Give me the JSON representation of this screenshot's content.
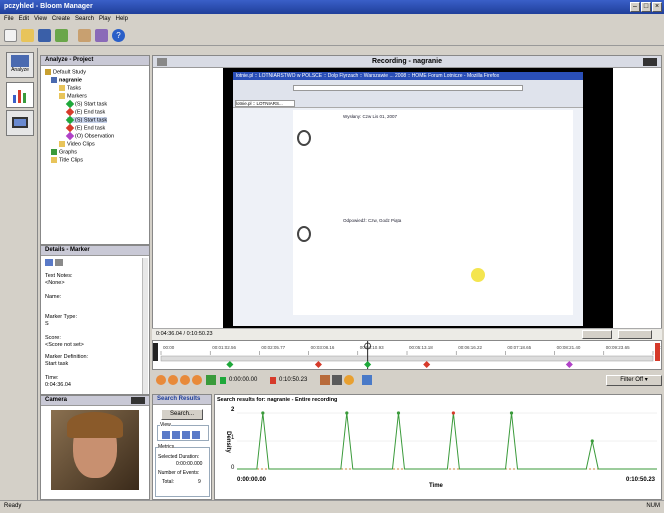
{
  "window": {
    "title": "pczyhled - Bloom Manager"
  },
  "menu": [
    "File",
    "Edit",
    "View",
    "Create",
    "Search",
    "Play",
    "Help"
  ],
  "toolbar_icons": [
    "new-icon",
    "open-icon",
    "save-icon",
    "import-icon",
    "users-icon",
    "export-icon",
    "help-icon"
  ],
  "leftnav": {
    "analyze_label": "Analyze"
  },
  "project": {
    "title": "Analyze - Project",
    "items": [
      {
        "label": "Default Study",
        "icon": "study-icon"
      },
      {
        "label": "nagranie",
        "icon": "recording-icon"
      },
      {
        "label": "Tasks",
        "icon": "folder-icon"
      },
      {
        "label": "Markers",
        "icon": "folder-icon"
      },
      {
        "label": "(S) Start task",
        "icon": "marker-icon"
      },
      {
        "label": "(E) End task",
        "icon": "marker-icon"
      },
      {
        "label": "(S) Start task",
        "icon": "marker-icon"
      },
      {
        "label": "(E) End task",
        "icon": "marker-icon"
      },
      {
        "label": "(O) Observation",
        "icon": "observation-icon"
      },
      {
        "label": "Video Clips",
        "icon": "folder-icon"
      },
      {
        "label": "Graphs",
        "icon": "graph-icon"
      },
      {
        "label": "Title Clips",
        "icon": "folder-icon"
      }
    ]
  },
  "details": {
    "title": "Details - Marker",
    "text_notes_label": "Text Notes:",
    "text_notes_value": "<None>",
    "name_label": "Name:",
    "marker_type_label": "Marker Type:",
    "marker_type_value": "S",
    "score_label": "Score:",
    "score_value": "<Score not set>",
    "marker_def_label": "Marker Definition:",
    "marker_def_value": "Start task",
    "time_label": "Time:",
    "time_value": "0:04:36.04"
  },
  "camera": {
    "title": "Camera"
  },
  "recording": {
    "title": "Recording - nagranie",
    "time_display": "0:04:36.04 / 0:10:50.23",
    "browser_title": "lotnie.pl :: LOTNIARSTWO w POLSCE :: Dolp Flyrzach :: Warszawie ... 2008 :: HOME Forum Lotnicze - Mozilla Firefox",
    "browser_tab": "lotnie.pl :: LOTNIARS...",
    "post_heading_1": "Wysłany: Czw Lis 01, 2007",
    "post_heading_2": "Odpowiedź: Czw, Godz Piąta"
  },
  "timeline": {
    "ticks": [
      "00:00",
      "00:01:02.56",
      "00:02:05.77",
      "00:03:08.16",
      "00:04:10.93",
      "00:05:13.18",
      "00:06:16.22",
      "00:07:18.65",
      "00:08:21.40",
      "00:09:23.65",
      "00:10:23.99"
    ],
    "current_position_fraction": 0.42,
    "start_time": "0:00:00.00",
    "end_time": "0:10:50.23",
    "filter_label": "Filter Off"
  },
  "search_results": {
    "title": "Search Results",
    "search_button": "Search...",
    "view_label": "View",
    "metrics_label": "Metrics",
    "selected_duration_label": "Selected Duration:",
    "selected_duration_value": "0:00:00.000",
    "events_label": "Number of Events:",
    "total_label": "Total:",
    "total_value": "9"
  },
  "graph": {
    "title": "Search results for: nagranie - Entire recording",
    "ylabel": "Density",
    "xlabel": "Time",
    "x_start": "0:00:00.00",
    "x_end": "0:10:50.23",
    "y_top": "2",
    "y_mid": "1",
    "y_bottom": "0"
  },
  "chart_data": {
    "type": "line",
    "xlabel": "Time",
    "ylabel": "Density",
    "ylim": [
      0,
      2
    ],
    "xlim": [
      "0:00:00.00",
      "0:10:50.23"
    ],
    "series": [
      {
        "x": [
          "0:00:40",
          "0:02:50",
          "0:04:10",
          "0:05:35",
          "0:07:05",
          "0:09:10"
        ],
        "values": [
          2,
          2,
          2,
          2,
          2,
          1
        ]
      }
    ]
  },
  "status": {
    "left": "Ready",
    "right": "NUM"
  },
  "colors": {
    "titlebar": "#2a4fb8",
    "marker_green": "#1ea83a",
    "marker_red": "#d63a2a",
    "marker_purple": "#b042c8",
    "graph_line": "#3a9a3a"
  }
}
